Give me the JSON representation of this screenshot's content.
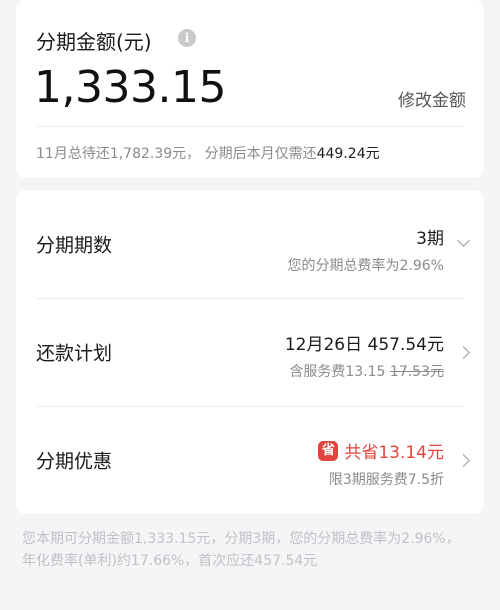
{
  "amount_card": {
    "title": "分期金额(元)",
    "info_icon": "info-icon",
    "amount": "1,333.15",
    "modify_label": "修改金额",
    "summary_prefix": "11月总待还1,782.39元，  分期后本月仅需还",
    "summary_value": "449.24元"
  },
  "details": {
    "term": {
      "label": "分期期数",
      "value": "3期",
      "subtext": "您的分期总费率为2.96%"
    },
    "plan": {
      "label": "还款计划",
      "value": "12月26日 457.54元",
      "fee_prefix": "含服务费13.15",
      "fee_original": "17.53元"
    },
    "offer": {
      "label": "分期优惠",
      "badge": "省",
      "value": "共省13.14元",
      "subtext": "限3期服务费7.5折"
    }
  },
  "footnote": "您本期可分期金额1,333.15元，分期3期，您的分期总费率为2.96%，年化费率(单利)约17.66%，首次应还457.54元",
  "colors": {
    "background": "#f4f5f7",
    "card": "#ffffff",
    "accent_red": "#e2453d",
    "muted_text": "#8b8b8b"
  }
}
